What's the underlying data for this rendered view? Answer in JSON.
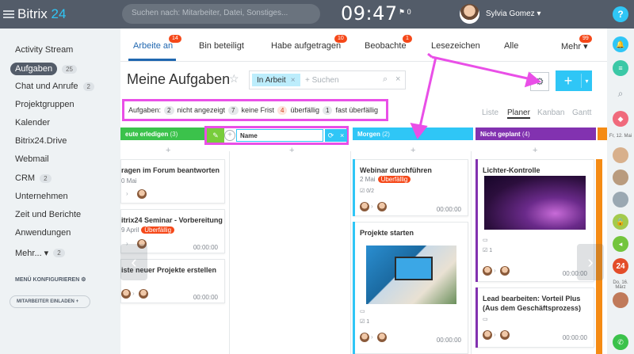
{
  "app": {
    "logo_name": "Bitrix",
    "logo_num": "24",
    "search_placeholder": "Suchen nach: Mitarbeiter, Datei, Sonstiges...",
    "clock": "09:47",
    "flag_glyph": "⚑ 0",
    "user_name": "Sylvia Gomez ▾",
    "help": "?"
  },
  "sidebar": {
    "items": [
      {
        "label": "Activity Stream",
        "count": ""
      },
      {
        "label": "Aufgaben",
        "count": "25"
      },
      {
        "label": "Chat und Anrufe",
        "count": "2"
      },
      {
        "label": "Projektgruppen",
        "count": ""
      },
      {
        "label": "Kalender",
        "count": ""
      },
      {
        "label": "Bitrix24.Drive",
        "count": ""
      },
      {
        "label": "Webmail",
        "count": ""
      },
      {
        "label": "CRM",
        "count": "2"
      },
      {
        "label": "Unternehmen",
        "count": ""
      },
      {
        "label": "Zeit und Berichte",
        "count": ""
      },
      {
        "label": "Anwendungen",
        "count": ""
      },
      {
        "label": "Mehr... ▾",
        "count": "2"
      }
    ],
    "config_label": "MENÜ KONFIGURIEREN",
    "invite_label": "MITARBEITER EINLADEN"
  },
  "tabs": [
    {
      "label": "Arbeite an",
      "badge": "14"
    },
    {
      "label": "Bin beteiligt",
      "badge": ""
    },
    {
      "label": "Habe aufgetragen",
      "badge": "10"
    },
    {
      "label": "Beobachte",
      "badge": "1"
    },
    {
      "label": "Lesezeichen",
      "badge": ""
    },
    {
      "label": "Alle",
      "badge": ""
    },
    {
      "label": "Mehr ▾",
      "badge": "99"
    }
  ],
  "page": {
    "title": "Meine Aufgaben",
    "filter_tag": "In Arbeit",
    "filter_placeholder": "+ Suchen"
  },
  "counters": {
    "label": "Aufgaben:",
    "items": [
      {
        "count": "2",
        "label": "nicht angezeigt"
      },
      {
        "count": "7",
        "label": "keine Frist"
      },
      {
        "count": "4",
        "label": "überfällig"
      },
      {
        "count": "1",
        "label": "fast überfällig"
      }
    ]
  },
  "views": [
    "Liste",
    "Planer",
    "Kanban",
    "Gantt"
  ],
  "stages": [
    {
      "name": "eute erledigen",
      "count": "(3)",
      "color": "#3bc24b"
    },
    {
      "name": "Morgen",
      "count": "(2)",
      "color": "#2fc6f6"
    },
    {
      "name": "Nicht geplant",
      "count": "(4)",
      "color": "#8232b0"
    }
  ],
  "new_column": {
    "name": "Name"
  },
  "cards": {
    "today": [
      {
        "title": "ragen im Forum beantworten",
        "date": "0 Mai",
        "overdue": "",
        "time": ""
      },
      {
        "title": "itrix24 Seminar - Vorbereitung",
        "date": "9 April",
        "overdue": "Überfällig",
        "time": "00:00:00"
      },
      {
        "title": "iste neuer Projekte erstellen",
        "date": "",
        "overdue": "",
        "time": "00:00:00"
      }
    ],
    "tomorrow": [
      {
        "title": "Webinar durchführen",
        "date": "2 Mai",
        "overdue": "Überfällig",
        "time": "00:00:00",
        "sub": "0/2"
      },
      {
        "title": "Projekte starten",
        "date": "",
        "overdue": "",
        "time": "00:00:00",
        "sub": "1"
      }
    ],
    "unplanned": [
      {
        "title": "Lichter-Kontrolle",
        "date": "",
        "overdue": "",
        "time": "00:00:00",
        "sub": "1"
      },
      {
        "title": "Lead bearbeiten: Vorteil Plus (Aus dem Geschäftsprozess)",
        "date": "",
        "overdue": "",
        "time": "00:00:00",
        "sub": ""
      }
    ]
  },
  "rail": {
    "date1": "Fr, 12. Mai",
    "date2": "Do, 16. März",
    "logo_24": "24"
  }
}
